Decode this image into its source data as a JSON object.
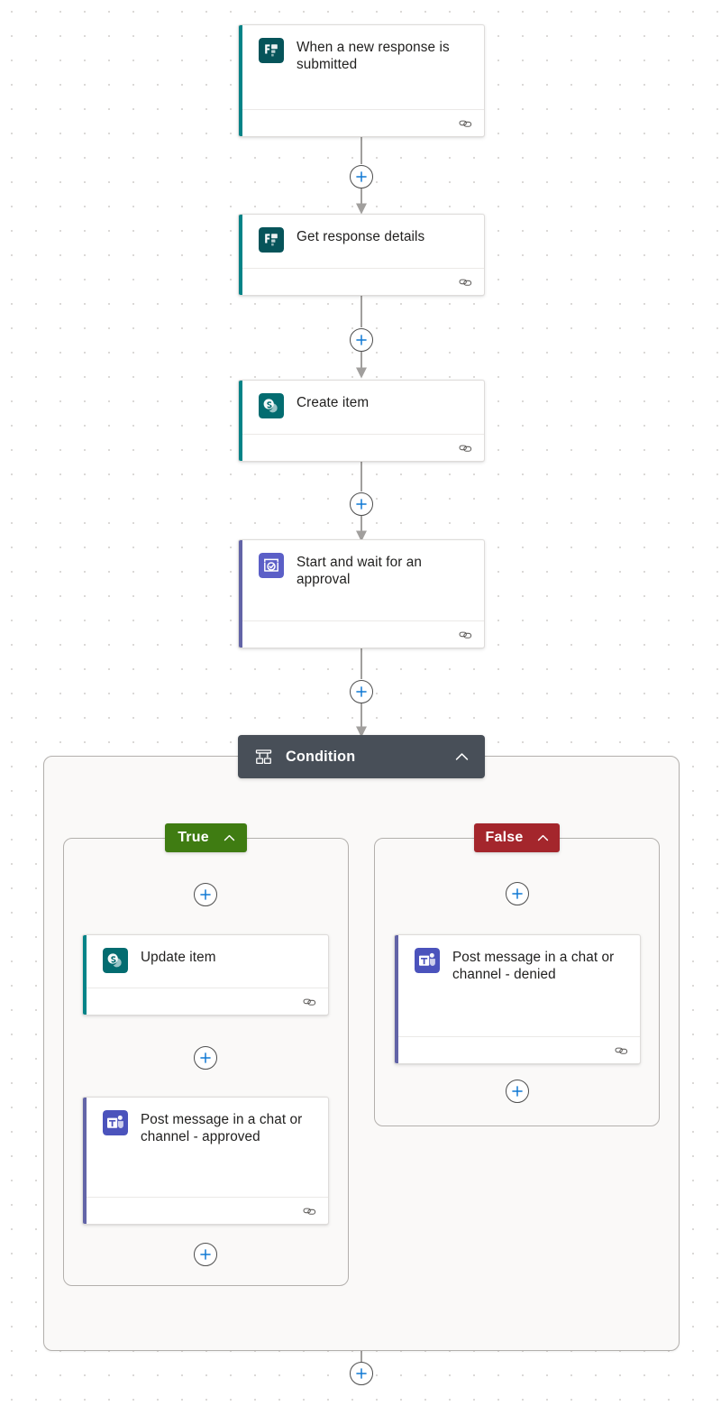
{
  "app": {
    "surface": "power-automate-flow-designer-canvas",
    "canvas_background": "#ffffff",
    "grid_dot_color": "#d8d6d4"
  },
  "colors": {
    "forms_icon": "#06545a",
    "sharepoint_icon": "#036c70",
    "approvals_icon": "#5b5fc7",
    "teams_icon": "#4b53bc",
    "accent_teal": "#038387",
    "accent_purple": "#6264a7",
    "condition_bar": "#484f58",
    "true_green": "#3f7c12",
    "false_red": "#a4262c",
    "plus_blue": "#0f78d4",
    "connector_gray": "#a19f9d",
    "scope_fill": "#faf9f8",
    "scope_border": "#b3b0ad"
  },
  "nodes": {
    "trigger": {
      "title": "When a new response is submitted",
      "icon": "microsoft-forms-icon",
      "accent": "#038387",
      "footer_icon": "link-icon"
    },
    "get_response": {
      "title": "Get response details",
      "icon": "microsoft-forms-icon",
      "accent": "#038387",
      "footer_icon": "link-icon"
    },
    "create_item": {
      "title": "Create item",
      "icon": "sharepoint-icon",
      "accent": "#038387",
      "footer_icon": "link-icon"
    },
    "approval": {
      "title": "Start and wait for an approval",
      "icon": "approvals-icon",
      "accent": "#6264a7",
      "footer_icon": "link-icon"
    },
    "condition": {
      "title": "Condition",
      "icon": "condition-branch-icon",
      "collapse_icon": "chevron-up-icon"
    },
    "branch_true": {
      "label": "True",
      "collapse_icon": "chevron-up-icon",
      "color": "#3f7c12"
    },
    "branch_false": {
      "label": "False",
      "collapse_icon": "chevron-up-icon",
      "color": "#a4262c"
    },
    "update_item": {
      "title": "Update item",
      "icon": "sharepoint-icon",
      "accent": "#038387",
      "footer_icon": "link-icon"
    },
    "post_approved": {
      "title": "Post message in a chat or channel - approved",
      "icon": "microsoft-teams-icon",
      "accent": "#6264a7",
      "footer_icon": "link-icon"
    },
    "post_denied": {
      "title": "Post message in a chat or channel - denied",
      "icon": "microsoft-teams-icon",
      "accent": "#6264a7",
      "footer_icon": "link-icon"
    }
  },
  "add_buttons": [
    {
      "id": "add-after-trigger",
      "label": "+"
    },
    {
      "id": "add-after-get-response",
      "label": "+"
    },
    {
      "id": "add-after-create-item",
      "label": "+"
    },
    {
      "id": "add-after-approval",
      "label": "+"
    },
    {
      "id": "add-true-branch-first",
      "label": "+"
    },
    {
      "id": "add-true-branch-second",
      "label": "+"
    },
    {
      "id": "add-true-branch-end",
      "label": "+"
    },
    {
      "id": "add-false-branch-first",
      "label": "+"
    },
    {
      "id": "add-false-branch-end",
      "label": "+"
    },
    {
      "id": "add-after-condition",
      "label": "+"
    }
  ]
}
